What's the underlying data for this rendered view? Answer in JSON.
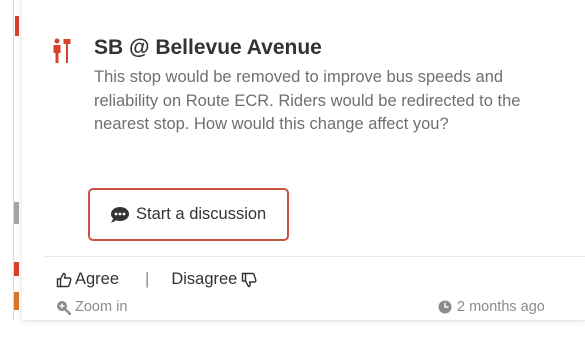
{
  "stop": {
    "title": "SB @ Bellevue Avenue",
    "description": "This stop would be removed to improve bus speeds and reliability on Route ECR. Riders would be redirected to the nearest stop. How would this change affect you?",
    "icon": "bus-stop-pin-icon"
  },
  "discussion": {
    "button_label": "Start a discussion",
    "icon": "comment-icon"
  },
  "votes": {
    "agree_label": "Agree",
    "separator": "|",
    "disagree_label": "Disagree",
    "agree_icon": "thumbs-up-icon",
    "disagree_icon": "thumbs-down-icon"
  },
  "meta": {
    "zoom_label": "Zoom in",
    "zoom_icon": "zoom-in-icon",
    "timestamp": "2 months ago",
    "time_icon": "clock-icon"
  },
  "colors": {
    "accent_red": "#c8553d",
    "title_text": "#333333",
    "body_text": "#6f6f6f",
    "meta_text": "#8c8c8c"
  }
}
